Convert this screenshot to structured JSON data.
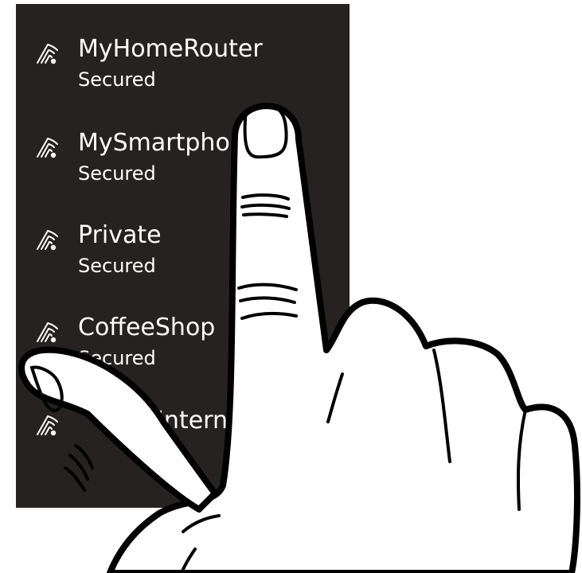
{
  "wifi_panel": {
    "networks": [
      {
        "name": "MyHomeRouter",
        "status": "Secured",
        "icon": "wifi-signal-icon"
      },
      {
        "name": "MySmartpho",
        "status": "Secured",
        "icon": "wifi-signal-icon"
      },
      {
        "name": "Private",
        "status": "Secured",
        "icon": "wifi-signal-icon"
      },
      {
        "name": "CoffeeShop",
        "status": "Secured",
        "icon": "wifi-signal-icon"
      },
      {
        "name": "ryIntern",
        "status": "",
        "icon": "wifi-signal-icon"
      }
    ]
  },
  "colors": {
    "panel_background": "#262221",
    "text": "#ffffff",
    "hand_fill": "#ffffff",
    "hand_outline": "#000000"
  },
  "overlay": {
    "icon": "pointing-hand-icon"
  }
}
